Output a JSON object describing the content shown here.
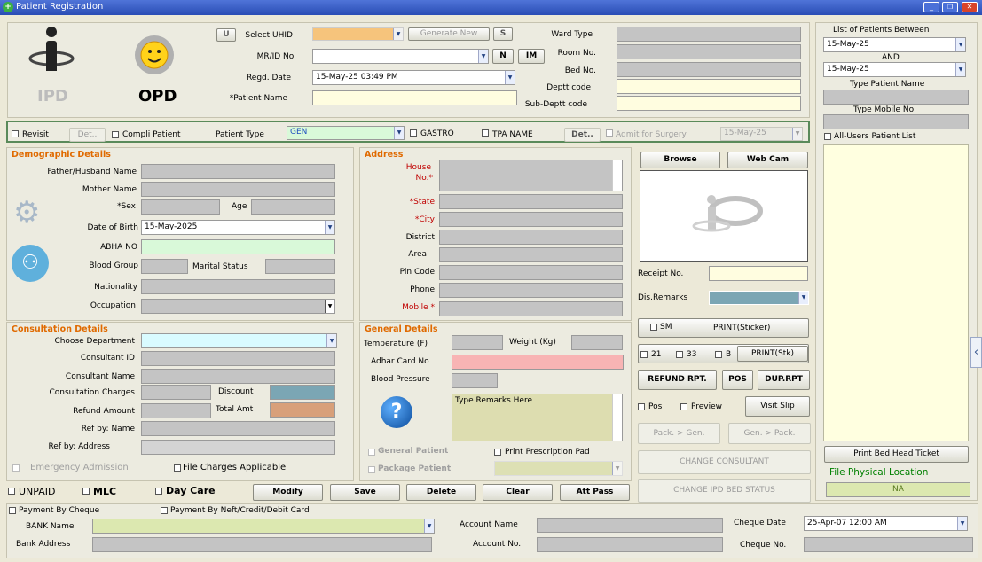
{
  "window": {
    "title": "Patient Registration"
  },
  "header": {
    "ipd": "IPD",
    "opd": "OPD",
    "u_btn": "U",
    "select_uhid": "Select UHID",
    "generate_new": "Generate New",
    "s_btn": "S",
    "mrid": "MR/ID No.",
    "n_btn": "N",
    "im_btn": "IM",
    "regd_date": "Regd. Date",
    "regd_date_value": "15-May-25 03:49 PM",
    "patient_name": "*Patient Name",
    "ward_type": "Ward Type",
    "room_no": "Room No.",
    "bed_no": "Bed No.",
    "deptt_code": "Deptt code",
    "sub_deptt_code": "Sub-Deptt code"
  },
  "sidebar": {
    "list_between": "List of Patients Between",
    "date_from": "15-May-25",
    "and": "AND",
    "date_to": "15-May-25",
    "type_name": "Type Patient Name",
    "type_mobile": "Type Mobile No",
    "all_users": "All-Users Patient List",
    "print_bed": "Print Bed Head Ticket",
    "file_location": "File Physical Location",
    "na": "NA"
  },
  "bar": {
    "revisit": "Revisit",
    "det": "Det..",
    "compli": "Compli Patient",
    "patient_type": "Patient Type",
    "patient_type_value": "GEN",
    "gastro": "GASTRO",
    "tpa": "TPA NAME",
    "det2": "Det..",
    "admit": "Admit for Surgery",
    "admit_date": "15-May-25"
  },
  "demo": {
    "title": "Demographic Details",
    "father": "Father/Husband Name",
    "mother": "Mother Name",
    "sex": "*Sex",
    "age": "Age",
    "dob": "Date of Birth",
    "dob_value": "15-May-2025",
    "abha": "ABHA NO",
    "blood_group": "Blood Group",
    "marital": "Marital Status",
    "nationality": "Nationality",
    "occupation": "Occupation"
  },
  "address": {
    "title": "Address",
    "house": "House",
    "house2": "No.*",
    "state": "*State",
    "city": "*City",
    "district": "District",
    "area": "Area",
    "pin": "Pin Code",
    "phone": "Phone",
    "mobile": "Mobile *"
  },
  "photo": {
    "browse": "Browse",
    "webcam": "Web Cam",
    "receipt": "Receipt No.",
    "dis_remarks": "Dis.Remarks"
  },
  "consult": {
    "title": "Consultation Details",
    "dept": "Choose Department",
    "cid": "Consultant ID",
    "cname": "Consultant Name",
    "charges": "Consultation Charges",
    "discount": "Discount",
    "refund": "Refund Amount",
    "total": "Total Amt",
    "refby": "Ref by: Name",
    "refaddr": "Ref by: Address",
    "emergency": "Emergency Admission",
    "file_charges": "File Charges Applicable"
  },
  "general": {
    "title": "General Details",
    "temp": "Temperature (F)",
    "weight": "Weight (Kg)",
    "adhar": "Adhar Card No",
    "bp": "Blood Pressure",
    "remarks": "Type Remarks Here",
    "gen_patient": "General Patient",
    "pkg_patient": "Package Patient",
    "print_presc": "Print Prescription Pad"
  },
  "actions": {
    "sm": "SM",
    "print_sticker": "PRINT(Sticker)",
    "c21": "21",
    "c33": "33",
    "cb": "B",
    "print_stk": "PRINT(Stk)",
    "refund_rpt": "REFUND RPT.",
    "pos": "POS",
    "dup_rpt": "DUP.RPT",
    "pos_cb": "Pos",
    "preview": "Preview",
    "visit_slip": "Visit Slip",
    "pack_gen": "Pack. > Gen.",
    "gen_pack": "Gen. > Pack.",
    "change_consultant": "CHANGE CONSULTANT",
    "change_ipd": "CHANGE IPD BED STATUS"
  },
  "bottom": {
    "unpaid": "UNPAID",
    "mlc": "MLC",
    "daycare": "Day Care",
    "modify": "Modify",
    "save": "Save",
    "delete": "Delete",
    "clear": "Clear",
    "attpass": "Att Pass",
    "pay_cheque": "Payment By Cheque",
    "pay_neft": "Payment By Neft/Credit/Debit Card",
    "bank_name": "BANK Name",
    "bank_address": "Bank Address",
    "account_name": "Account Name",
    "account_no": "Account No.",
    "cheque_date": "Cheque Date",
    "cheque_date_value": "25-Apr-07 12:00 AM",
    "cheque_no": "Cheque No."
  },
  "colors": {
    "titlebar": "#3a5fcd",
    "section": "#e06a00",
    "bar_border": "#5a8a5a"
  }
}
